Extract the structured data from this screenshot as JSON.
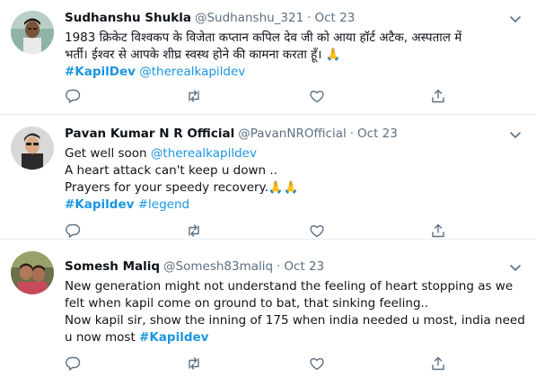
{
  "tweets": [
    {
      "name": "Sudhanshu Shukla",
      "handle": "@Sudhanshu_321",
      "separator": "·",
      "time": "Oct 23",
      "lines": [
        "1983 क्रिकेट विश्वकप के विजेता कप्तान कपिल देव जी को आया हॉर्ट अटैक, अस्पताल में",
        "भर्ती। ईश्वर से आपके शीघ्र स्वस्थ होने की कामना करता हूँ। 🙏"
      ],
      "hashtag": "#KapilDev",
      "mention": "@therealkapildev"
    },
    {
      "name": "Pavan Kumar N R Official",
      "handle": "@PavanNROfficial",
      "separator": "·",
      "time": "Oct 23",
      "line1_prefix": "Get well soon ",
      "line1_mention": "@therealkapildev",
      "line2": "A heart attack can't keep u down ..",
      "line3": "Prayers for your speedy recovery.🙏🙏",
      "hashtag1": "#Kapildev",
      "hashtag2": "#legend"
    },
    {
      "name": "Somesh Maliq",
      "handle": "@Somesh83maliq",
      "separator": "·",
      "time": "Oct 23",
      "line1": "New generation might not understand the feeling of heart stopping as we",
      "line2": "felt when kapil come on ground to bat, that sinking feeling..",
      "line3": "Now kapil sir, show the inning of 175 when india needed u most, india need",
      "line4_prefix": "u now most ",
      "hashtag": "#Kapildev"
    }
  ],
  "icons": {
    "reply": "reply-icon",
    "retweet": "retweet-icon",
    "like": "like-icon",
    "share": "share-icon",
    "more": "chevron-down-icon"
  },
  "colors": {
    "link": "#1b95e0",
    "muted": "#5b7083",
    "divider": "#e6ecf0"
  }
}
